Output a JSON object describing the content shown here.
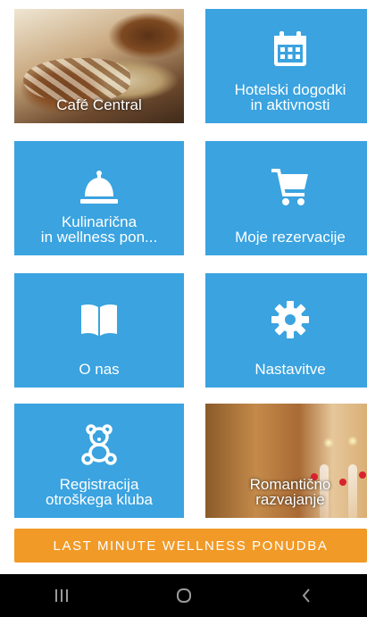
{
  "tiles": [
    {
      "name": "cafe-central",
      "lines": [
        "Café Central"
      ],
      "type": "photo"
    },
    {
      "name": "hotel-events",
      "lines": [
        "Hotelski dogodki",
        "in aktivnosti"
      ],
      "icon": "calendar-icon"
    },
    {
      "name": "culinary-wellness",
      "lines": [
        "Kulinarična",
        "in wellness pon..."
      ],
      "icon": "service-bell-icon"
    },
    {
      "name": "my-reservations",
      "lines": [
        "Moje rezervacije"
      ],
      "icon": "shopping-cart-icon"
    },
    {
      "name": "about-us",
      "lines": [
        "O nas"
      ],
      "icon": "open-book-icon"
    },
    {
      "name": "settings",
      "lines": [
        "Nastavitve"
      ],
      "icon": "gear-icon"
    },
    {
      "name": "kids-club-registration",
      "lines": [
        "Registracija",
        "otroškega kluba"
      ],
      "icon": "teddy-bear-icon"
    },
    {
      "name": "romantic-pampering",
      "lines": [
        "Romantično",
        "razvajanje"
      ],
      "type": "photo"
    }
  ],
  "cta": {
    "label": "LAST MINUTE WELLNESS PONUDBA"
  },
  "navbar": {
    "recents_icon": "recent-apps-icon",
    "home_icon": "home-icon",
    "back_icon": "back-icon"
  },
  "colors": {
    "tile": "#3aa3e0",
    "cta": "#f19a27",
    "navbar": "#000000"
  }
}
